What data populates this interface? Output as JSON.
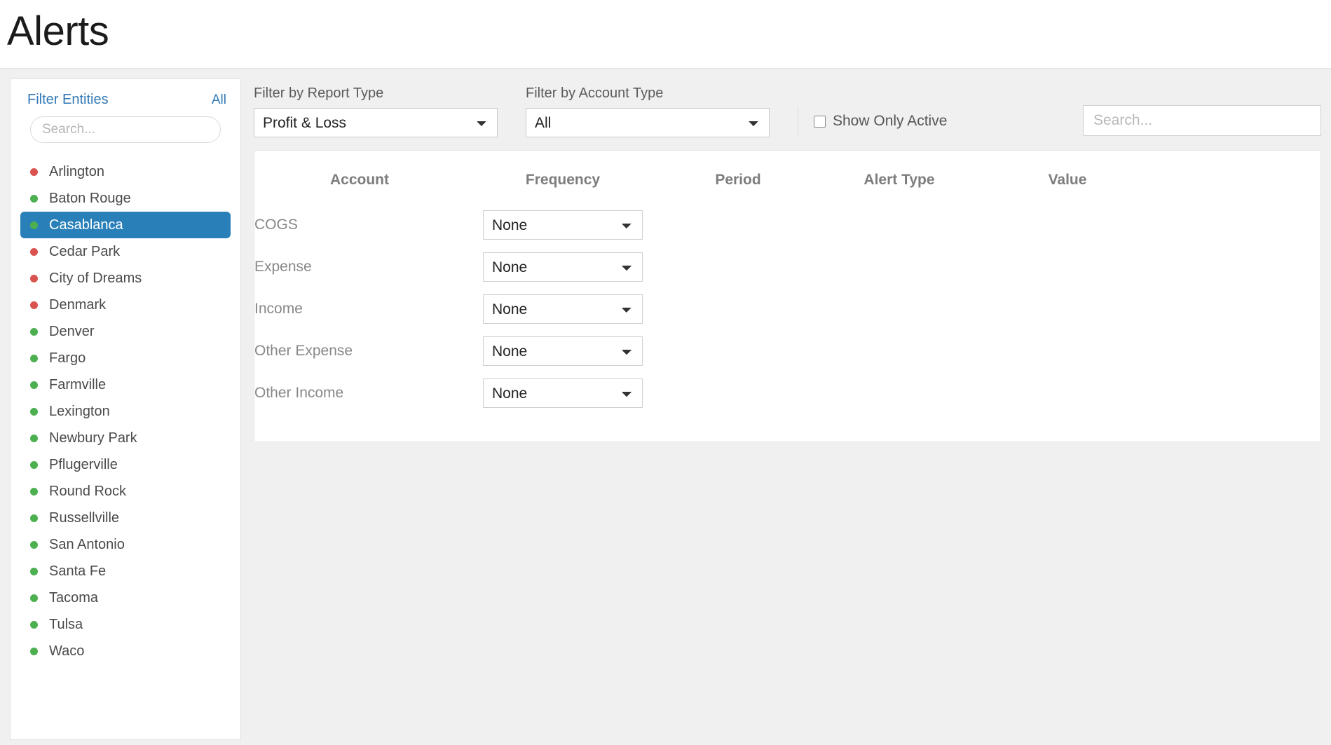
{
  "header": {
    "title": "Alerts"
  },
  "sidebar": {
    "filter_label": "Filter Entities",
    "all_link": "All",
    "search_placeholder": "Search...",
    "search_value": "",
    "entities": [
      {
        "name": "Arlington",
        "status": "red"
      },
      {
        "name": "Baton Rouge",
        "status": "green"
      },
      {
        "name": "Casablanca",
        "status": "green",
        "selected": true
      },
      {
        "name": "Cedar Park",
        "status": "red"
      },
      {
        "name": "City of Dreams",
        "status": "red"
      },
      {
        "name": "Denmark",
        "status": "red"
      },
      {
        "name": "Denver",
        "status": "green"
      },
      {
        "name": "Fargo",
        "status": "green"
      },
      {
        "name": "Farmville",
        "status": "green"
      },
      {
        "name": "Lexington",
        "status": "green"
      },
      {
        "name": "Newbury Park",
        "status": "green"
      },
      {
        "name": "Pflugerville",
        "status": "green"
      },
      {
        "name": "Round Rock",
        "status": "green"
      },
      {
        "name": "Russellville",
        "status": "green"
      },
      {
        "name": "San Antonio",
        "status": "green"
      },
      {
        "name": "Santa Fe",
        "status": "green"
      },
      {
        "name": "Tacoma",
        "status": "green"
      },
      {
        "name": "Tulsa",
        "status": "green"
      },
      {
        "name": "Waco",
        "status": "green"
      }
    ]
  },
  "filters": {
    "report_type": {
      "label": "Filter by Report Type",
      "value": "Profit & Loss",
      "options": [
        "Profit & Loss"
      ]
    },
    "account_type": {
      "label": "Filter by Account Type",
      "value": "All",
      "options": [
        "All"
      ]
    },
    "show_only_active": {
      "label": "Show Only Active",
      "checked": false
    },
    "search": {
      "placeholder": "Search...",
      "value": ""
    }
  },
  "table": {
    "columns": [
      "Account",
      "Frequency",
      "Period",
      "Alert Type",
      "Value"
    ],
    "rows": [
      {
        "account": "COGS",
        "frequency": "None",
        "period": "",
        "alert_type": "",
        "value": ""
      },
      {
        "account": "Expense",
        "frequency": "None",
        "period": "",
        "alert_type": "",
        "value": ""
      },
      {
        "account": "Income",
        "frequency": "None",
        "period": "",
        "alert_type": "",
        "value": ""
      },
      {
        "account": "Other Expense",
        "frequency": "None",
        "period": "",
        "alert_type": "",
        "value": ""
      },
      {
        "account": "Other Income",
        "frequency": "None",
        "period": "",
        "alert_type": "",
        "value": ""
      }
    ],
    "frequency_options": [
      "None"
    ]
  },
  "colors": {
    "accent_blue": "#337ab7",
    "selected_blue": "#2980b9",
    "status_green": "#4caf50",
    "status_red": "#d9534f",
    "page_background": "#f0f0f0"
  }
}
